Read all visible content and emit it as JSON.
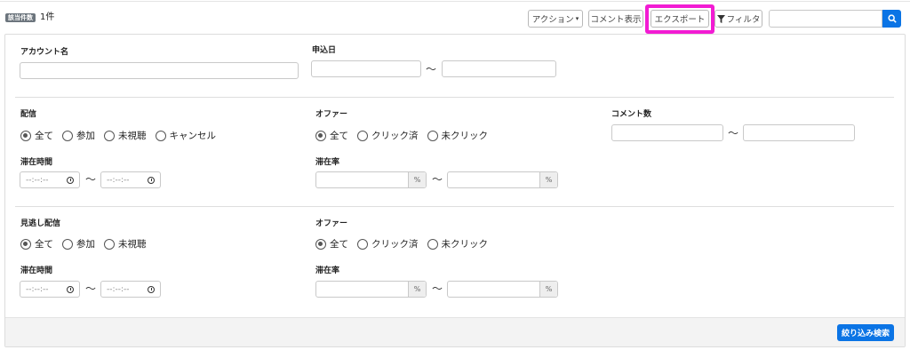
{
  "header": {
    "count_badge": "該当件数",
    "count_value": "1件"
  },
  "toolbar": {
    "action_label": "アクション",
    "comment_label": "コメント表示",
    "export_label": "エクスポート",
    "filter_label": "フィルタ",
    "search_value": ""
  },
  "colors": {
    "accent": "#0b74e5",
    "highlight": "#f21bd3"
  },
  "filters": {
    "account_label": "アカウント名",
    "apply_date_label": "申込日",
    "tilde": "〜",
    "live": {
      "label": "配信",
      "options": [
        "全て",
        "参加",
        "未視聴",
        "キャンセル"
      ],
      "selected": "全て",
      "stay_label": "滞在時間",
      "time_placeholder": "--:--:--"
    },
    "offer1": {
      "label": "オファー",
      "options": [
        "全て",
        "クリック済",
        "未クリック"
      ],
      "selected": "全て",
      "rate_label": "滞在率",
      "unit": "%"
    },
    "comment_count_label": "コメント数",
    "replay": {
      "label": "見逃し配信",
      "options": [
        "全て",
        "参加",
        "未視聴"
      ],
      "selected": "全て",
      "stay_label": "滞在時間",
      "time_placeholder": "--:--:--"
    },
    "offer2": {
      "label": "オファー",
      "options": [
        "全て",
        "クリック済",
        "未クリック"
      ],
      "selected": "全て",
      "rate_label": "滞在率",
      "unit": "%"
    }
  },
  "footer": {
    "submit_label": "絞り込み検索"
  }
}
